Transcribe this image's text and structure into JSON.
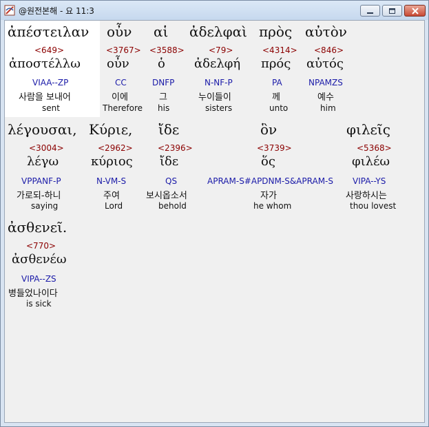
{
  "window": {
    "title": "@원전본해 - 요 11:3",
    "icons": {
      "app": "app-logo-icon",
      "minimize": "minimize-icon",
      "maximize": "maximize-icon",
      "close": "close-icon"
    }
  },
  "rows": [
    [
      {
        "greek": "ἀπέστειλαν",
        "strong": "<649>",
        "lemma": "ἀποστέλλω",
        "morph": "VIAA--ZP",
        "korean": "사람을 보내어",
        "english": "sent"
      },
      {
        "greek": "οὖν",
        "strong": "<3767>",
        "lemma": "οὖν",
        "morph": "CC",
        "korean": "이에",
        "english": "Therefore"
      },
      {
        "greek": "αἱ",
        "strong": "<3588>",
        "lemma": "ὁ",
        "morph": "DNFP",
        "korean": "그",
        "english": "his"
      },
      {
        "greek": "ἀδελφαὶ",
        "strong": "<79>",
        "lemma": "ἀδελφή",
        "morph": "N-NF-P",
        "korean": "누이들이",
        "english": "sisters"
      },
      {
        "greek": "πρὸς",
        "strong": "<4314>",
        "lemma": "πρός",
        "morph": "PA",
        "korean": "께",
        "english": "unto"
      },
      {
        "greek": "αὐτὸν",
        "strong": "<846>",
        "lemma": "αὐτός",
        "morph": "NPAMZS",
        "korean": "예수",
        "english": "him"
      }
    ],
    [
      {
        "greek": "λέγουσαι,",
        "strong": "<3004>",
        "lemma": "λέγω",
        "morph": "VPPANF-P",
        "korean": "가로되-하니",
        "english": "saying"
      },
      {
        "greek": "Κύριε,",
        "strong": "<2962>",
        "lemma": "κύριος",
        "morph": "N-VM-S",
        "korean": "주여",
        "english": "Lord"
      },
      {
        "greek": "ἴδε",
        "strong": "<2396>",
        "lemma": "ἴδε",
        "morph": "QS",
        "korean": "보시옵소서",
        "english": "behold"
      },
      {
        "greek": "ὃν",
        "strong": "<3739>",
        "lemma": "ὅς",
        "morph": "APRAM-S#APDNM-S&APRAM-S",
        "korean": "자가",
        "english": "he whom"
      },
      {
        "greek": "φιλεῖς",
        "strong": "<5368>",
        "lemma": "φιλέω",
        "morph": "VIPA--YS",
        "korean": "사랑하시는",
        "english": "thou lovest"
      }
    ],
    [
      {
        "greek": "ἀσθενεῖ.",
        "strong": "<770>",
        "lemma": "ἀσθενέω",
        "morph": "VIPA--ZS",
        "korean": "병들었나이다",
        "english": "is sick"
      }
    ]
  ]
}
